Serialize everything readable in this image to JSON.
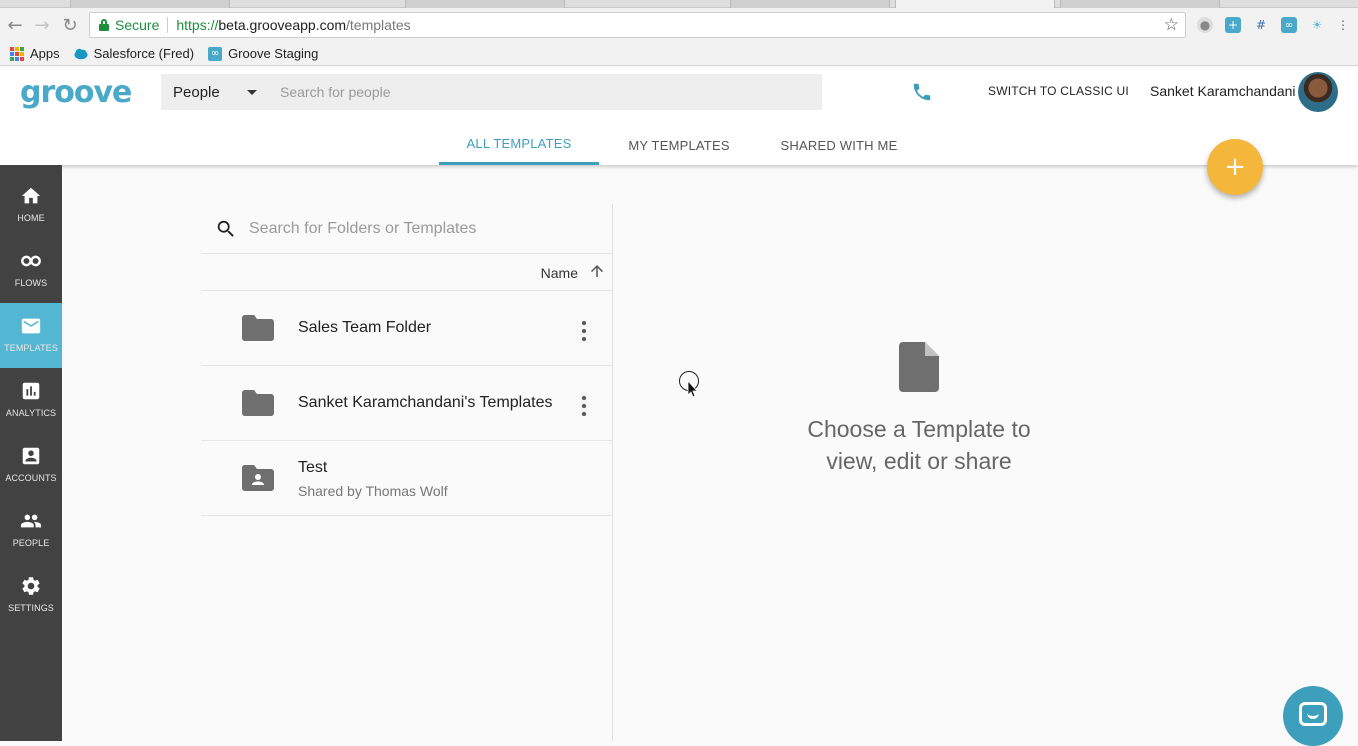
{
  "browser": {
    "secure_label": "Secure",
    "url_scheme": "https://",
    "url_host": "beta.grooveapp.com",
    "url_path": "/templates",
    "bookmarks": [
      {
        "label": "Apps",
        "icon": "apps-grid-icon"
      },
      {
        "label": "Salesforce (Fred)",
        "icon": "salesforce-cloud-icon"
      },
      {
        "label": "Groove Staging",
        "icon": "groove-icon"
      }
    ]
  },
  "header": {
    "logo_text": "groove",
    "search_scope": "People",
    "search_placeholder": "Search for people",
    "classic_ui_label": "SWITCH TO CLASSIC UI",
    "user_name": "Sanket Karamchandani",
    "tabs": [
      {
        "label": "ALL TEMPLATES",
        "active": true
      },
      {
        "label": "MY TEMPLATES",
        "active": false
      },
      {
        "label": "SHARED WITH ME",
        "active": false
      }
    ],
    "fab_label": "+"
  },
  "sidebar": {
    "items": [
      {
        "label": "HOME",
        "icon": "home-icon"
      },
      {
        "label": "FLOWS",
        "icon": "infinity-icon"
      },
      {
        "label": "TEMPLATES",
        "icon": "envelope-icon",
        "active": true
      },
      {
        "label": "ANALYTICS",
        "icon": "bar-chart-icon"
      },
      {
        "label": "ACCOUNTS",
        "icon": "account-box-icon"
      },
      {
        "label": "PEOPLE",
        "icon": "people-icon"
      },
      {
        "label": "SETTINGS",
        "icon": "gear-icon"
      }
    ]
  },
  "list": {
    "search_placeholder": "Search for Folders or Templates",
    "sort_label": "Name",
    "sort_direction": "ascending",
    "rows": [
      {
        "name": "Sales Team Folder",
        "subtitle": "",
        "icon": "folder-icon"
      },
      {
        "name": "Sanket Karamchandani's Templates",
        "subtitle": "",
        "icon": "folder-icon"
      },
      {
        "name": "Test",
        "subtitle": "Shared by Thomas Wolf",
        "icon": "shared-folder-icon"
      }
    ]
  },
  "empty_state": {
    "line1": "Choose a Template to",
    "line2": "view, edit or share",
    "icon": "document-icon"
  },
  "colors": {
    "accent": "#3e9fbd",
    "sidebar_bg": "#424242",
    "sidebar_active": "#53b7d3",
    "fab": "#f5b73b"
  }
}
